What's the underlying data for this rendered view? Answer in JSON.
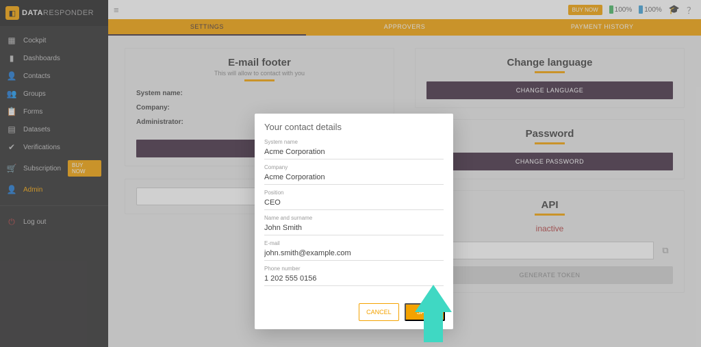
{
  "brand": {
    "name_bold": "DATA",
    "name_light": "RESPONDER"
  },
  "topbar": {
    "buy_now": "BUY NOW",
    "batt1": "100%",
    "batt2": "100%"
  },
  "sidebar": {
    "items": [
      {
        "label": "Cockpit",
        "icon": "▦"
      },
      {
        "label": "Dashboards",
        "icon": "▮"
      },
      {
        "label": "Contacts",
        "icon": "👤"
      },
      {
        "label": "Groups",
        "icon": "👥"
      },
      {
        "label": "Forms",
        "icon": "📋"
      },
      {
        "label": "Datasets",
        "icon": "▤"
      },
      {
        "label": "Verifications",
        "icon": "✔"
      },
      {
        "label": "Subscription",
        "icon": "🛒",
        "buy": "BUY NOW"
      },
      {
        "label": "Admin",
        "icon": "👤",
        "active": true
      }
    ],
    "logout": {
      "label": "Log out",
      "icon": "⏻"
    }
  },
  "tabs": [
    {
      "label": "SETTINGS",
      "active": true
    },
    {
      "label": "APPROVERS"
    },
    {
      "label": "PAYMENT HISTORY"
    }
  ],
  "email_footer": {
    "title": "E-mail footer",
    "subtitle": "This will allow to contact with you",
    "fields": {
      "system_name": "System name:",
      "company": "Company:",
      "administrator": "Administrator:"
    }
  },
  "language": {
    "title": "Change language",
    "button": "CHANGE LANGUAGE"
  },
  "password": {
    "title": "Password",
    "button": "CHANGE PASSWORD"
  },
  "api": {
    "title": "API",
    "status": "inactive",
    "generate": "GENERATE TOKEN"
  },
  "dialog": {
    "title": "Your contact details",
    "fields": {
      "system_name": {
        "label": "System name",
        "value": "Acme Corporation"
      },
      "company": {
        "label": "Company",
        "value": "Acme Corporation"
      },
      "position": {
        "label": "Position",
        "value": "CEO"
      },
      "name": {
        "label": "Name and surname",
        "value": "John Smith"
      },
      "email": {
        "label": "E-mail",
        "value": "john.smith@example.com"
      },
      "phone": {
        "label": "Phone number",
        "value": "1 202 555 0156"
      }
    },
    "cancel": "CANCEL",
    "save": "SAVE"
  }
}
